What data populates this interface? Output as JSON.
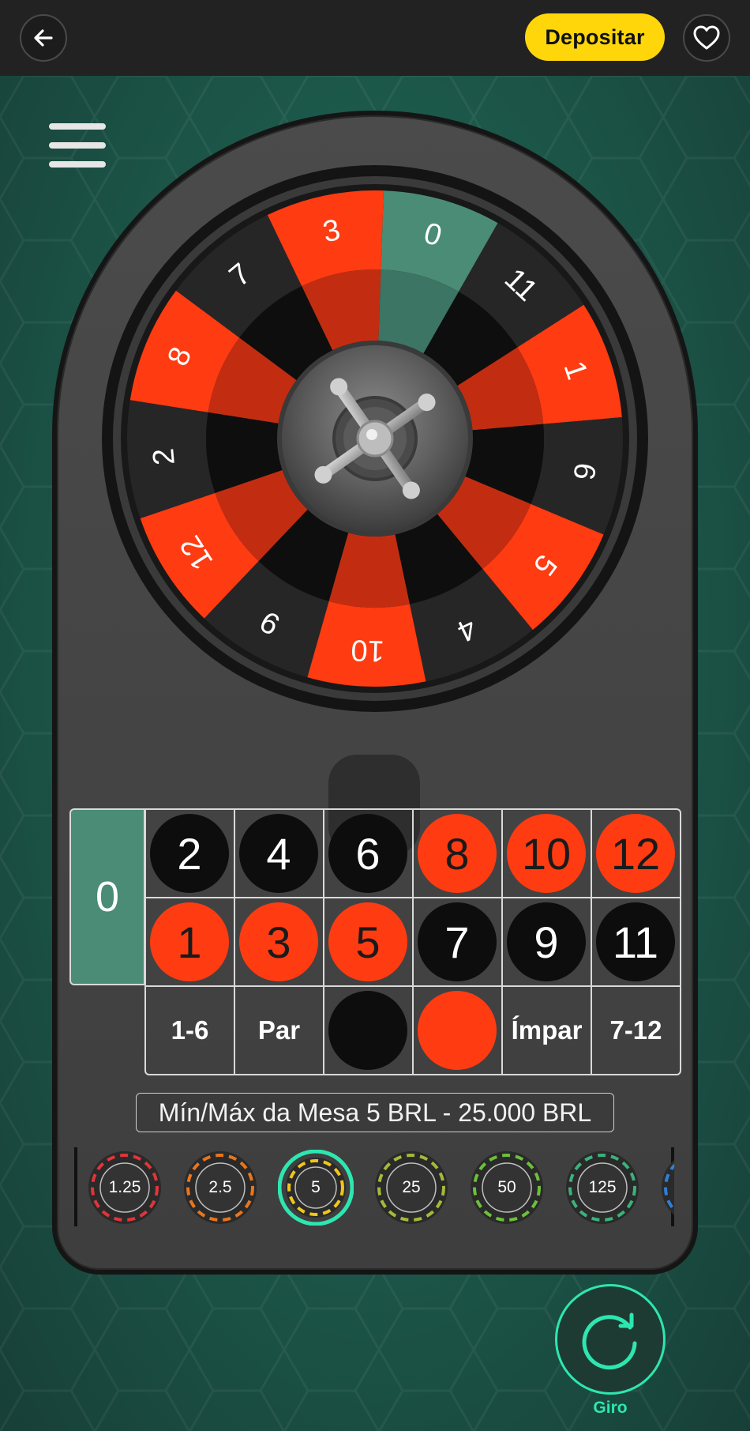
{
  "header": {
    "back_icon": "arrow-left-icon",
    "deposit_label": "Depositar",
    "favorite_icon": "heart-icon"
  },
  "menu": {
    "icon": "hamburger-menu-icon"
  },
  "wheel": {
    "pockets": [
      {
        "label": "0",
        "color": "green"
      },
      {
        "label": "11",
        "color": "black"
      },
      {
        "label": "1",
        "color": "red"
      },
      {
        "label": "6",
        "color": "black"
      },
      {
        "label": "5",
        "color": "red"
      },
      {
        "label": "4",
        "color": "black"
      },
      {
        "label": "10",
        "color": "red"
      },
      {
        "label": "9",
        "color": "black"
      },
      {
        "label": "12",
        "color": "red"
      },
      {
        "label": "2",
        "color": "black"
      },
      {
        "label": "8",
        "color": "red"
      },
      {
        "label": "7",
        "color": "black"
      },
      {
        "label": "3",
        "color": "red"
      }
    ]
  },
  "board": {
    "zero": "0",
    "top_row": [
      {
        "label": "2",
        "color": "black"
      },
      {
        "label": "4",
        "color": "black"
      },
      {
        "label": "6",
        "color": "black"
      },
      {
        "label": "8",
        "color": "red"
      },
      {
        "label": "10",
        "color": "red"
      },
      {
        "label": "12",
        "color": "red"
      }
    ],
    "bottom_row": [
      {
        "label": "1",
        "color": "red"
      },
      {
        "label": "3",
        "color": "red"
      },
      {
        "label": "5",
        "color": "red"
      },
      {
        "label": "7",
        "color": "black"
      },
      {
        "label": "9",
        "color": "black"
      },
      {
        "label": "11",
        "color": "black"
      }
    ],
    "outside": [
      "1-6",
      "Par",
      "",
      "",
      "Ímpar",
      "7-12"
    ]
  },
  "limits_text": "Mín/Máx da Mesa 5 BRL - 25.000 BRL",
  "chips": [
    {
      "value": "1.25",
      "accent": "#e0353a",
      "selected": false
    },
    {
      "value": "2.5",
      "accent": "#e8761e",
      "selected": false
    },
    {
      "value": "5",
      "accent": "#f2c51c",
      "selected": true
    },
    {
      "value": "25",
      "accent": "#a7b83a",
      "selected": false
    },
    {
      "value": "50",
      "accent": "#6cc03a",
      "selected": false
    },
    {
      "value": "125",
      "accent": "#3bb27a",
      "selected": false
    }
  ],
  "spin": {
    "label": "Giro",
    "icon": "refresh-arrow-icon"
  },
  "colors": {
    "red": "#ff3b12",
    "black": "#0d0d0d",
    "green": "#4a8c76",
    "accent_teal": "#2ee6b0",
    "deposit_yellow": "#ffd60a"
  }
}
